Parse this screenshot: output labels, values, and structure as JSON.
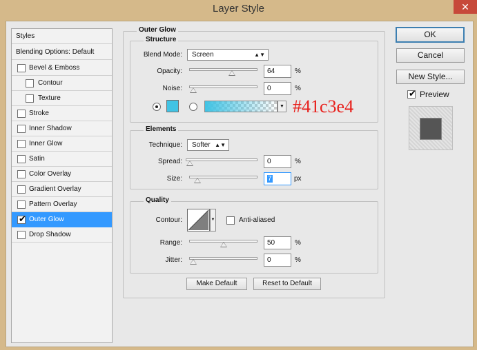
{
  "window": {
    "title": "Layer Style",
    "close_glyph": "✕"
  },
  "left_panel": {
    "items": [
      {
        "label": "Styles",
        "has_checkbox": false,
        "checked": false,
        "indent": false,
        "selected": false
      },
      {
        "label": "Blending Options: Default",
        "has_checkbox": false,
        "checked": false,
        "indent": false,
        "selected": false
      },
      {
        "label": "Bevel & Emboss",
        "has_checkbox": true,
        "checked": false,
        "indent": false,
        "selected": false
      },
      {
        "label": "Contour",
        "has_checkbox": true,
        "checked": false,
        "indent": true,
        "selected": false
      },
      {
        "label": "Texture",
        "has_checkbox": true,
        "checked": false,
        "indent": true,
        "selected": false
      },
      {
        "label": "Stroke",
        "has_checkbox": true,
        "checked": false,
        "indent": false,
        "selected": false
      },
      {
        "label": "Inner Shadow",
        "has_checkbox": true,
        "checked": false,
        "indent": false,
        "selected": false
      },
      {
        "label": "Inner Glow",
        "has_checkbox": true,
        "checked": false,
        "indent": false,
        "selected": false
      },
      {
        "label": "Satin",
        "has_checkbox": true,
        "checked": false,
        "indent": false,
        "selected": false
      },
      {
        "label": "Color Overlay",
        "has_checkbox": true,
        "checked": false,
        "indent": false,
        "selected": false
      },
      {
        "label": "Gradient Overlay",
        "has_checkbox": true,
        "checked": false,
        "indent": false,
        "selected": false
      },
      {
        "label": "Pattern Overlay",
        "has_checkbox": true,
        "checked": false,
        "indent": false,
        "selected": false
      },
      {
        "label": "Outer Glow",
        "has_checkbox": true,
        "checked": true,
        "indent": false,
        "selected": true
      },
      {
        "label": "Drop Shadow",
        "has_checkbox": true,
        "checked": false,
        "indent": false,
        "selected": false
      }
    ]
  },
  "outer_glow": {
    "section_title": "Outer Glow",
    "structure": {
      "title": "Structure",
      "blend_mode_label": "Blend Mode:",
      "blend_mode": "Screen",
      "opacity_label": "Opacity:",
      "opacity": "64",
      "opacity_fraction": 0.64,
      "opacity_unit": "%",
      "noise_label": "Noise:",
      "noise": "0",
      "noise_fraction": 0.0,
      "noise_unit": "%",
      "glow_color": "#41c3e4",
      "color_annotation": "#41c3e4",
      "annotation_color": "#e8201c"
    },
    "elements": {
      "title": "Elements",
      "technique_label": "Technique:",
      "technique": "Softer",
      "spread_label": "Spread:",
      "spread": "0",
      "spread_fraction": 0.0,
      "spread_unit": "%",
      "size_label": "Size:",
      "size": "7",
      "size_fraction": 0.07,
      "size_unit": "px"
    },
    "quality": {
      "title": "Quality",
      "contour_label": "Contour:",
      "anti_aliased_label": "Anti-aliased",
      "anti_aliased": false,
      "range_label": "Range:",
      "range": "50",
      "range_fraction": 0.5,
      "range_unit": "%",
      "jitter_label": "Jitter:",
      "jitter": "0",
      "jitter_fraction": 0.0,
      "jitter_unit": "%"
    },
    "make_default_label": "Make Default",
    "reset_default_label": "Reset to Default"
  },
  "right_buttons": {
    "ok": "OK",
    "cancel": "Cancel",
    "new_style": "New Style...",
    "preview_label": "Preview",
    "preview_checked": true,
    "preview_swatch_color": "#555555"
  }
}
